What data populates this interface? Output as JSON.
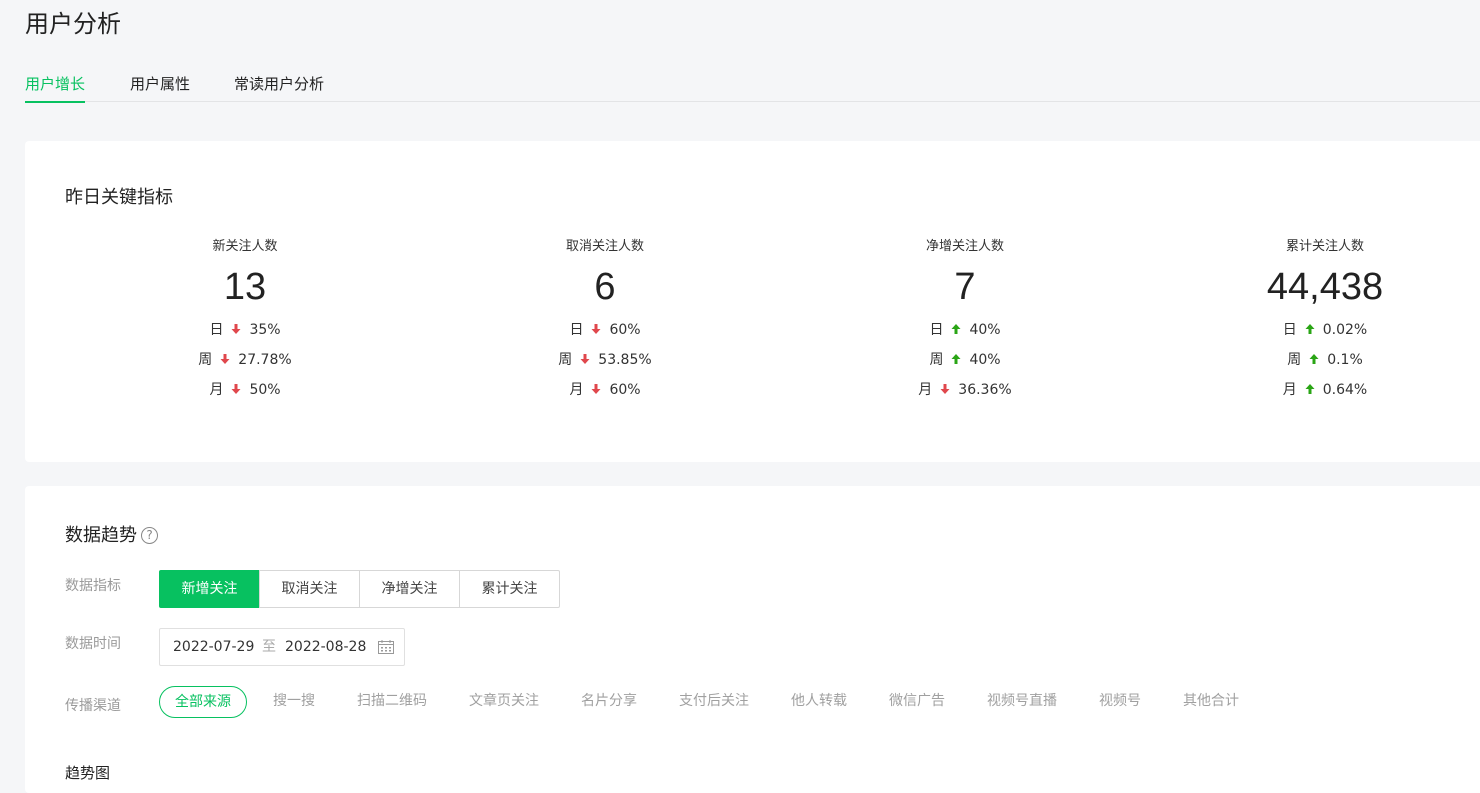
{
  "page_title": "用户分析",
  "tabs": [
    {
      "label": "用户增长",
      "active": true
    },
    {
      "label": "用户属性",
      "active": false
    },
    {
      "label": "常读用户分析",
      "active": false
    }
  ],
  "kpi_section": {
    "title": "昨日关键指标",
    "items": [
      {
        "label": "新关注人数",
        "value": "13",
        "changes": [
          {
            "period": "日",
            "direction": "down",
            "value": "35%"
          },
          {
            "period": "周",
            "direction": "down",
            "value": "27.78%"
          },
          {
            "period": "月",
            "direction": "down",
            "value": "50%"
          }
        ]
      },
      {
        "label": "取消关注人数",
        "value": "6",
        "changes": [
          {
            "period": "日",
            "direction": "down",
            "value": "60%"
          },
          {
            "period": "周",
            "direction": "down",
            "value": "53.85%"
          },
          {
            "period": "月",
            "direction": "down",
            "value": "60%"
          }
        ]
      },
      {
        "label": "净增关注人数",
        "value": "7",
        "changes": [
          {
            "period": "日",
            "direction": "up",
            "value": "40%"
          },
          {
            "period": "周",
            "direction": "up",
            "value": "40%"
          },
          {
            "period": "月",
            "direction": "down",
            "value": "36.36%"
          }
        ]
      },
      {
        "label": "累计关注人数",
        "value": "44,438",
        "changes": [
          {
            "period": "日",
            "direction": "up",
            "value": "0.02%"
          },
          {
            "period": "周",
            "direction": "up",
            "value": "0.1%"
          },
          {
            "period": "月",
            "direction": "up",
            "value": "0.64%"
          }
        ]
      }
    ]
  },
  "trend_section": {
    "title": "数据趋势",
    "help_icon": "?",
    "metric_label": "数据指标",
    "metric_options": [
      {
        "label": "新增关注",
        "active": true
      },
      {
        "label": "取消关注",
        "active": false
      },
      {
        "label": "净增关注",
        "active": false
      },
      {
        "label": "累计关注",
        "active": false
      }
    ],
    "time_label": "数据时间",
    "date_start": "2022-07-29",
    "date_separator": "至",
    "date_end": "2022-08-28",
    "channel_label": "传播渠道",
    "channels": [
      {
        "label": "全部来源",
        "active": true
      },
      {
        "label": "搜一搜",
        "active": false
      },
      {
        "label": "扫描二维码",
        "active": false
      },
      {
        "label": "文章页关注",
        "active": false
      },
      {
        "label": "名片分享",
        "active": false
      },
      {
        "label": "支付后关注",
        "active": false
      },
      {
        "label": "他人转载",
        "active": false
      },
      {
        "label": "微信广告",
        "active": false
      },
      {
        "label": "视频号直播",
        "active": false
      },
      {
        "label": "视频号",
        "active": false
      },
      {
        "label": "其他合计",
        "active": false
      }
    ],
    "chart_title": "趋势图"
  },
  "colors": {
    "accent": "#07c160",
    "down_arrow": "#e0474c",
    "up_arrow": "#2aa515"
  }
}
